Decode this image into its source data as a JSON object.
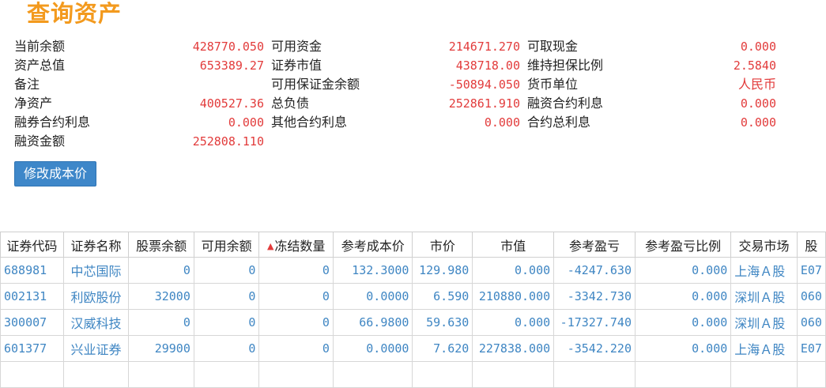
{
  "page": {
    "title": "查询资产"
  },
  "summary": {
    "current_balance": {
      "label": "当前余额",
      "value": "428770.050"
    },
    "available_funds": {
      "label": "可用资金",
      "value": "214671.270"
    },
    "withdrawable_cash": {
      "label": "可取现金",
      "value": "0.000"
    },
    "total_assets": {
      "label": "资产总值",
      "value": "653389.27"
    },
    "securities_market_value": {
      "label": "证券市值",
      "value": "438718.00"
    },
    "maintenance_ratio": {
      "label": "维持担保比例",
      "value": "2.5840"
    },
    "remarks": {
      "label": "备注",
      "value": ""
    },
    "available_margin_balance": {
      "label": "可用保证金余额",
      "value": "-50894.050"
    },
    "currency": {
      "label": "货币单位",
      "value": "人民币"
    },
    "net_assets": {
      "label": "净资产",
      "value": "400527.36"
    },
    "total_liabilities": {
      "label": "总负债",
      "value": "252861.910"
    },
    "margin_financing_interest": {
      "label": "融资合约利息",
      "value": "0.000"
    },
    "securities_lending_interest": {
      "label": "融券合约利息",
      "value": "0.000"
    },
    "other_contract_interest": {
      "label": "其他合约利息",
      "value": "0.000"
    },
    "total_contract_interest": {
      "label": "合约总利息",
      "value": "0.000"
    },
    "financing_amount": {
      "label": "融资金额",
      "value": "252808.110"
    }
  },
  "buttons": {
    "modify_cost": "修改成本价"
  },
  "table": {
    "sort_icon": "▲",
    "headers": [
      "证券代码",
      "证券名称",
      "股票余额",
      "可用余额",
      "冻结数量",
      "参考成本价",
      "市价",
      "市值",
      "参考盈亏",
      "参考盈亏比例",
      "交易市场",
      "股"
    ],
    "rows": [
      [
        "688981",
        "中芯国际",
        "0",
        "0",
        "0",
        "132.3000",
        "129.980",
        "0.000",
        "-4247.630",
        "0.000",
        "上海Ａ股",
        "E07"
      ],
      [
        "002131",
        "利欧股份",
        "32000",
        "0",
        "0",
        "0.0000",
        "6.590",
        "210880.000",
        "-3342.730",
        "0.000",
        "深圳Ａ股",
        "060"
      ],
      [
        "300007",
        "汉威科技",
        "0",
        "0",
        "0",
        "66.9800",
        "59.630",
        "0.000",
        "-17327.740",
        "0.000",
        "深圳Ａ股",
        "060"
      ],
      [
        "601377",
        "兴业证券",
        "29900",
        "0",
        "0",
        "0.0000",
        "7.620",
        "227838.000",
        "-3542.220",
        "0.000",
        "上海Ａ股",
        "E07"
      ]
    ]
  }
}
